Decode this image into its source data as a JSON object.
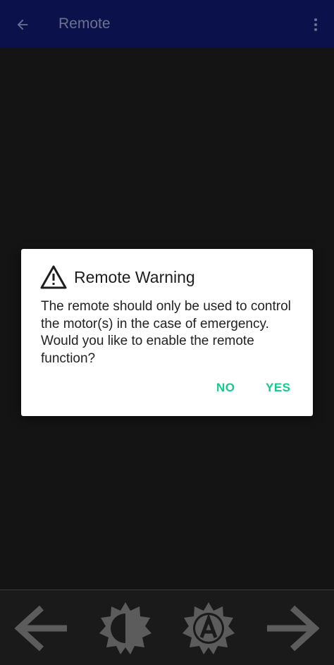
{
  "appbar": {
    "title": "Remote",
    "back_icon": "arrow-left-icon",
    "menu_icon": "more-vert-icon"
  },
  "dialog": {
    "title": "Remote Warning",
    "icon": "warning-icon",
    "message": "The remote should only be used to control the motor(s) in the case of emergency. Would you like to enable the remote function?",
    "no_label": "NO",
    "yes_label": "YES"
  },
  "bottom_bar": {
    "buttons": [
      {
        "icon": "arrow-left-icon"
      },
      {
        "icon": "brightness-icon"
      },
      {
        "icon": "auto-brightness-icon"
      },
      {
        "icon": "arrow-right-icon"
      }
    ]
  },
  "colors": {
    "appbar_bg": "#0b124b",
    "background": "#141414",
    "dialog_bg": "#ffffff",
    "accent": "#13c98e",
    "disabled_icon": "#5c5c5c"
  }
}
